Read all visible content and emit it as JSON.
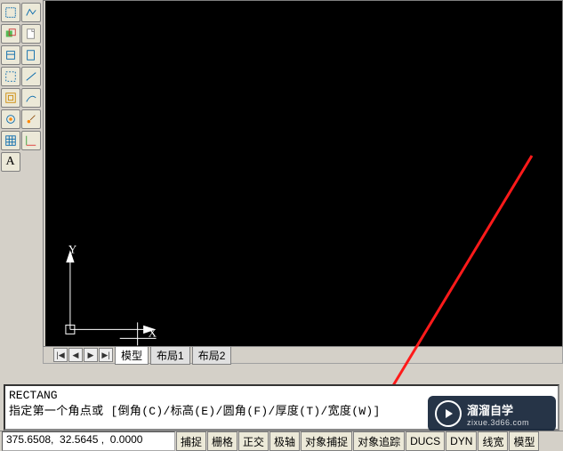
{
  "canvas": {
    "axis_x_label": "X",
    "axis_y_label": "Y"
  },
  "layout_tabs": {
    "nav": [
      "|◀",
      "◀",
      "▶",
      "▶|"
    ],
    "tabs": [
      "模型",
      "布局1",
      "布局2"
    ]
  },
  "command": {
    "line1": "RECTANG",
    "line2": "指定第一个角点或 [倒角(C)/标高(E)/圆角(F)/厚度(T)/宽度(W)]"
  },
  "status": {
    "coords": "375.6508,  32.5645 ,  0.0000",
    "buttons": [
      "捕捉",
      "栅格",
      "正交",
      "极轴",
      "对象捕捉",
      "对象追踪",
      "DUCS",
      "DYN",
      "线宽",
      "模型"
    ]
  },
  "watermark": {
    "title": "溜溜自学",
    "subtitle": "zixue.3d66.com"
  },
  "tools_a": [
    "page-setup",
    "layers",
    "properties",
    "crop",
    "bounds",
    "render",
    "grid",
    "text"
  ],
  "tools_b": [
    "polyline",
    "new",
    "open",
    "line",
    "pline",
    "brush",
    "axes"
  ]
}
